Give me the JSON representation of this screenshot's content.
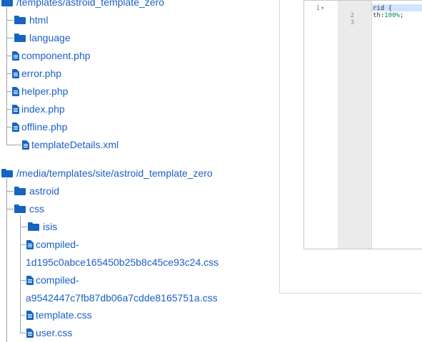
{
  "colors": {
    "link": "#1c5fc4",
    "icon": "#1565c0",
    "tree_line": "#9aa4ae",
    "active_line": "#d3e3fb"
  },
  "tree1": {
    "root": {
      "label": "/templates/astroid_template_zero",
      "icon": "folder-icon"
    },
    "items": [
      {
        "label": "html",
        "icon": "folder-icon"
      },
      {
        "label": "language",
        "icon": "folder-icon"
      },
      {
        "label": "component.php",
        "icon": "file-icon"
      },
      {
        "label": "error.php",
        "icon": "file-icon"
      },
      {
        "label": "helper.php",
        "icon": "file-icon"
      },
      {
        "label": "index.php",
        "icon": "file-icon"
      },
      {
        "label": "offline.php",
        "icon": "file-icon"
      },
      {
        "label": "templateDetails.xml",
        "icon": "file-icon"
      }
    ]
  },
  "tree2": {
    "root": {
      "label": "/media/templates/site/astroid_template_zero",
      "icon": "folder-icon"
    },
    "items": [
      {
        "label": "astroid",
        "icon": "folder-icon"
      },
      {
        "label": "css",
        "icon": "folder-icon"
      }
    ],
    "css_children": [
      {
        "label": "isis",
        "icon": "folder-icon"
      },
      {
        "label": "compiled-",
        "label2": "1d195c0abce165450b25b8c45ce93c24.css",
        "icon": "file-icon"
      },
      {
        "label": "compiled-",
        "label2": "a9542447c7fb87db06a7cdde8165751a.css",
        "icon": "file-icon"
      },
      {
        "label": "template.css",
        "icon": "file-icon"
      },
      {
        "label": "user.css",
        "icon": "file-icon"
      }
    ]
  },
  "editor": {
    "line_numbers": [
      "1",
      "2",
      "3"
    ],
    "fold_marker": "▾",
    "lines": [
      "rid {",
      "th:",
      "100%",
      ";"
    ]
  }
}
